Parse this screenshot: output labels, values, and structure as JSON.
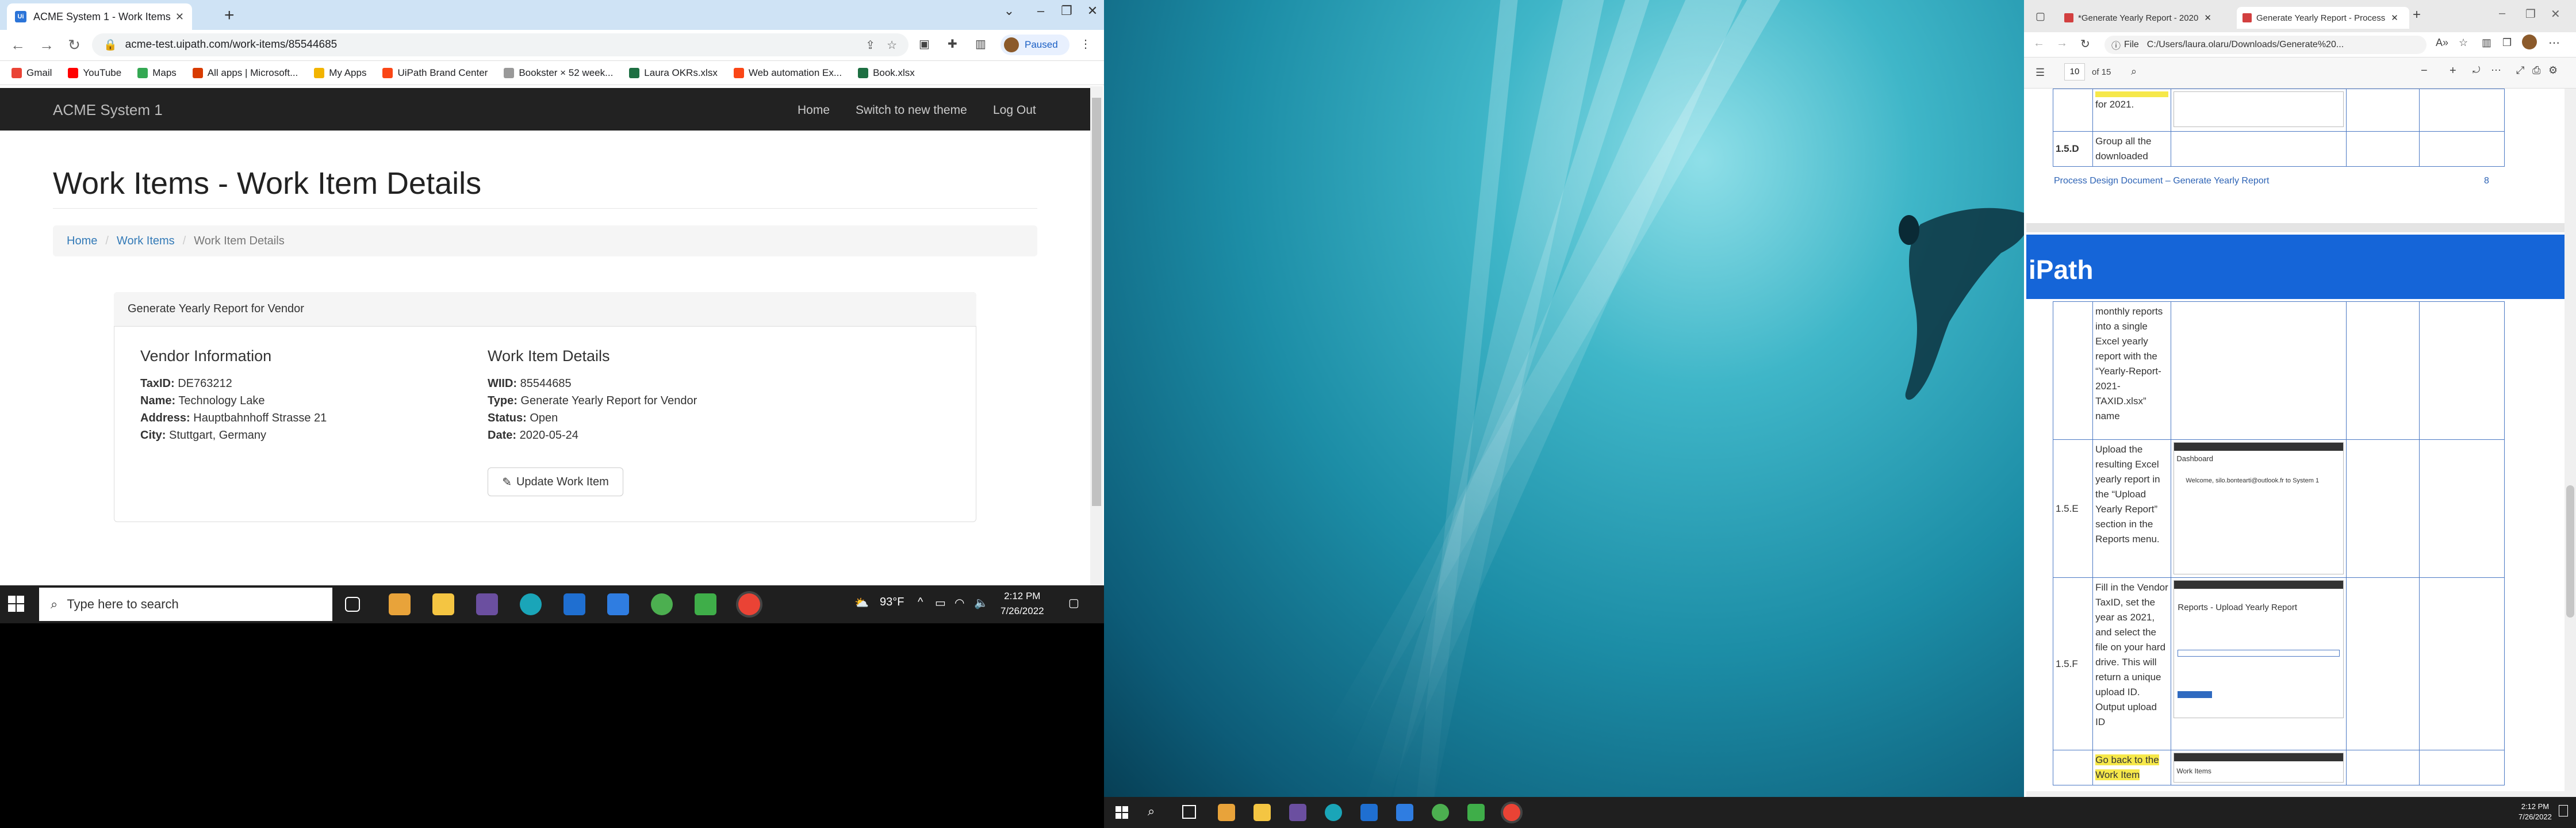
{
  "chrome": {
    "tab_title": "ACME System 1 - Work Items",
    "url": "acme-test.uipath.com/work-items/85544685",
    "profile_label": "Paused",
    "bookmarks": [
      "Gmail",
      "YouTube",
      "Maps",
      "All apps | Microsoft...",
      "My Apps",
      "UiPath Brand Center",
      "Bookster × 52 week...",
      "Laura OKRs.xlsx",
      "Web automation Ex...",
      "Book.xlsx"
    ]
  },
  "app": {
    "brand": "ACME System 1",
    "nav": [
      "Home",
      "Switch to new theme",
      "Log Out"
    ],
    "page_title": "Work Items - Work Item Details",
    "breadcrumb": [
      "Home",
      "Work Items",
      "Work Item Details"
    ],
    "panel_title": "Generate Yearly Report for Vendor",
    "vendor": {
      "heading": "Vendor Information",
      "rows": [
        {
          "label": "TaxID:",
          "value": "DE763212"
        },
        {
          "label": "Name:",
          "value": "Technology Lake"
        },
        {
          "label": "Address:",
          "value": "Hauptbahnhoff Strasse 21"
        },
        {
          "label": "City:",
          "value": "Stuttgart, Germany"
        }
      ]
    },
    "work_item": {
      "heading": "Work Item Details",
      "rows": [
        {
          "label": "WIID:",
          "value": "85544685"
        },
        {
          "label": "Type:",
          "value": "Generate Yearly Report for Vendor"
        },
        {
          "label": "Status:",
          "value": "Open"
        },
        {
          "label": "Date:",
          "value": "2020-05-24"
        }
      ]
    },
    "update_button": "Update Work Item"
  },
  "taskbar_left": {
    "search_placeholder": "Type here to search",
    "weather": "93°F",
    "time": "2:12 PM",
    "date": "7/26/2022"
  },
  "edge": {
    "tab1": "*Generate Yearly Report - 2020",
    "tab2": "Generate Yearly Report - Process",
    "file_label": "File",
    "address": "C:/Users/laura.olaru/Downloads/Generate%20...",
    "page_num": "10",
    "page_of": "of 15",
    "top_cell_text": "for 2021.",
    "row_15d_id": "1.5.D",
    "row_15d_text": "Group all the downloaded",
    "footer_link": "Process Design Document – Generate Yearly Report",
    "footer_page": "8",
    "banner_text": "iPath",
    "cont_text": "monthly reports into a single Excel yearly report with the “Yearly-Report-2021-TAXID.xlsx” name",
    "row_15e_id": "1.5.E",
    "row_15e_text": "Upload the resulting Excel yearly report in the “Upload Yearly Report” section in the Reports menu.",
    "row_15f_id": "1.5.F",
    "row_15f_text": "Fill in the Vendor TaxID, set the year as 2021, and select the file on your hard drive. This will return a unique upload ID. Output upload ID",
    "last_text": "Go back to the Work Item",
    "thumb_dashboard": "Dashboard",
    "thumb_welcome": "Welcome, silo.bontearti@outlook.fr to System 1",
    "thumb_upload": "Reports - Upload Yearly Report",
    "thumb_workitems": "Work Items"
  },
  "taskbar_right": {
    "time": "2:12 PM",
    "date": "7/26/2022"
  }
}
